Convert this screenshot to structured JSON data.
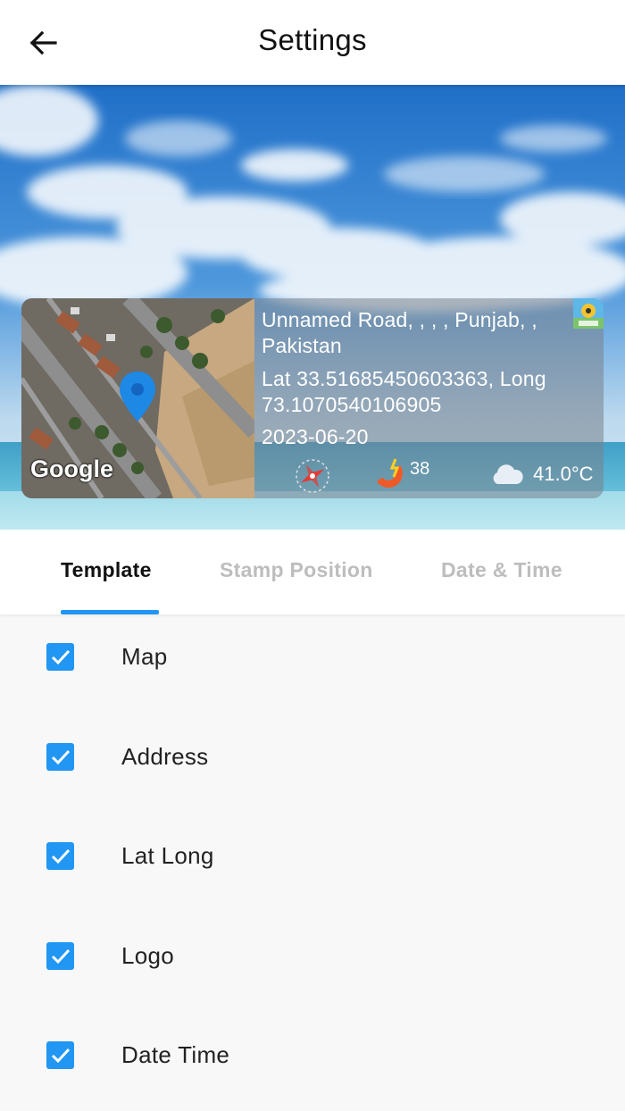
{
  "header": {
    "title": "Settings",
    "back_icon": "arrow-left-icon"
  },
  "stamp": {
    "address": "Unnamed Road, , , , Punjab, , Pakistan",
    "latlong": "Lat 33.51685450603363, Long 73.1070540106905",
    "date": "2023-06-20",
    "map_attribution": "Google",
    "magnetic_value": "38",
    "temperature": "41.0°C",
    "icons": [
      "compass-icon",
      "magnet-icon",
      "cloud-icon",
      "app-logo-icon",
      "map-pin-icon"
    ]
  },
  "tabs": [
    {
      "label": "Template",
      "active": true
    },
    {
      "label": "Stamp Position",
      "active": false
    },
    {
      "label": "Date & Time",
      "active": false
    }
  ],
  "options": [
    {
      "label": "Map",
      "checked": true
    },
    {
      "label": "Address",
      "checked": true
    },
    {
      "label": "Lat Long",
      "checked": true
    },
    {
      "label": "Logo",
      "checked": true
    },
    {
      "label": "Date Time",
      "checked": true
    }
  ],
  "colors": {
    "accent": "#2196f3",
    "text_primary": "#111111",
    "text_inactive": "#bdbdbd",
    "background": "#f8f8f8"
  }
}
